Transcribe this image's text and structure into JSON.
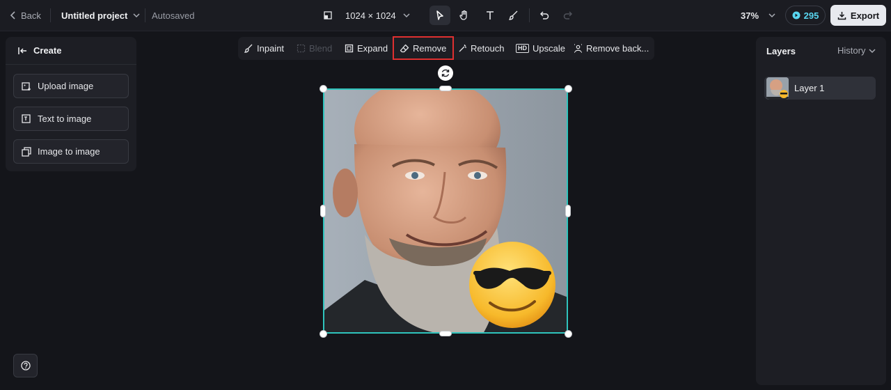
{
  "topbar": {
    "back_label": "Back",
    "project_name": "Untitled project",
    "save_status": "Autosaved",
    "canvas_size": "1024 × 1024",
    "zoom": "37%",
    "credits": "295",
    "export_label": "Export"
  },
  "tools": [
    "select-icon",
    "hand-icon",
    "text-icon",
    "brush-icon",
    "undo-icon",
    "redo-icon"
  ],
  "left_panel": {
    "title": "Create",
    "buttons": [
      "Upload image",
      "Text to image",
      "Image to image"
    ]
  },
  "context_toolbar": {
    "items": [
      "Inpaint",
      "Blend",
      "Expand",
      "Remove",
      "Retouch",
      "Upscale",
      "Remove back..."
    ],
    "upscale_badge": "HD",
    "disabled": [
      "Blend"
    ],
    "highlighted": "Remove"
  },
  "right_panel": {
    "title": "Layers",
    "history_label": "History",
    "layers": [
      "Layer 1"
    ]
  },
  "colors": {
    "background": "#14151a",
    "panel": "#1d1e24",
    "selection": "#2fc4bd",
    "highlight": "#e03030",
    "credits": "#58d6f0"
  }
}
